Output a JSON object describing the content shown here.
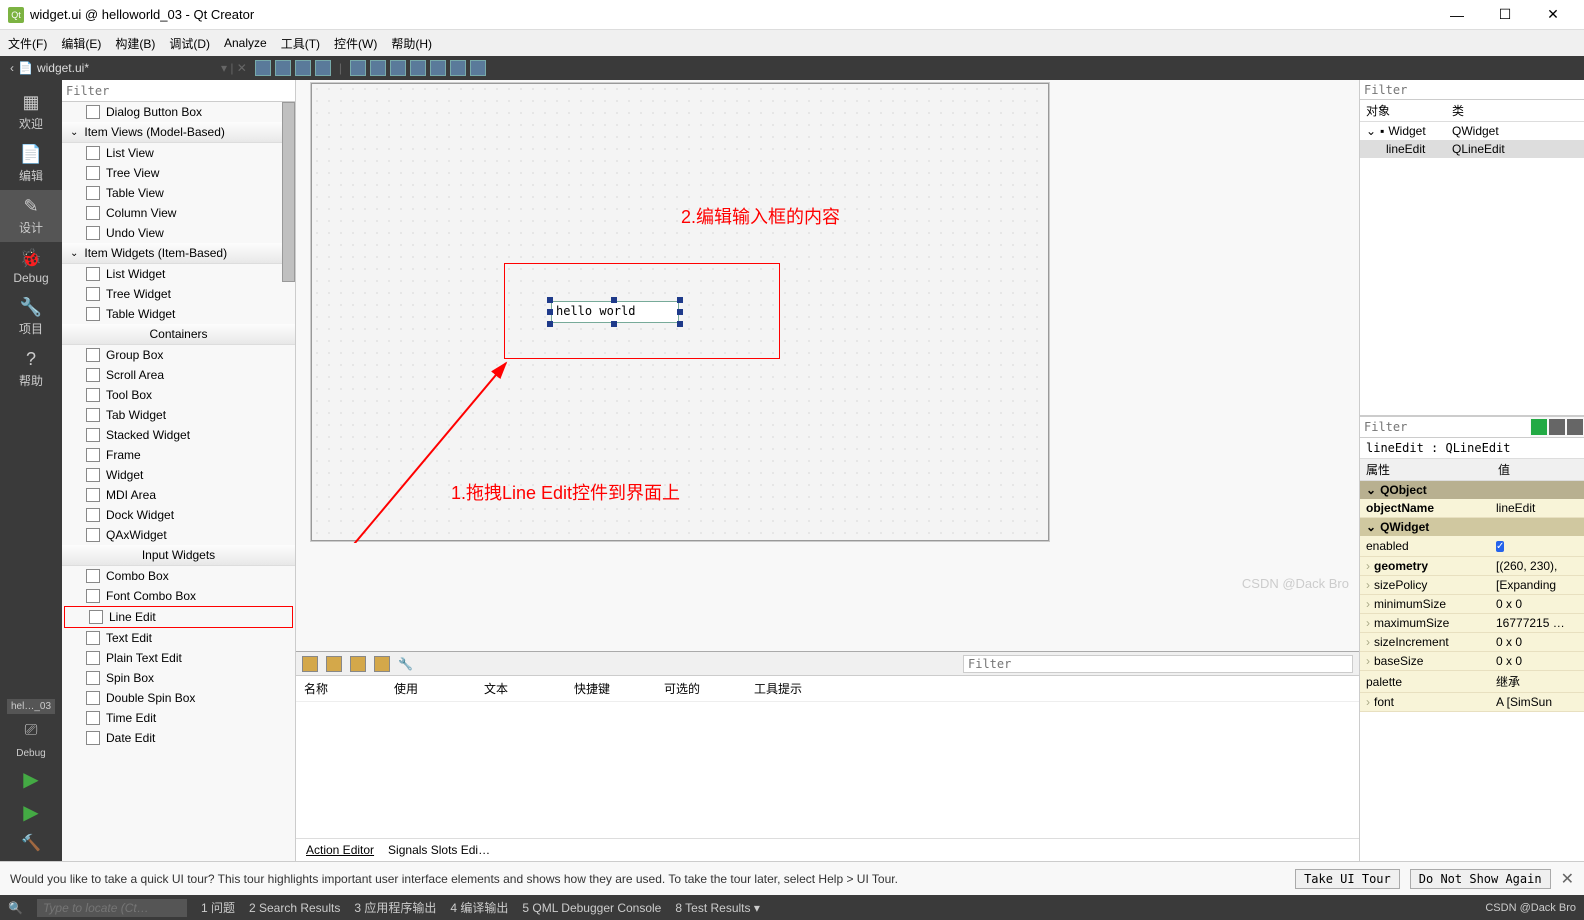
{
  "titlebar": {
    "title": "widget.ui @ helloworld_03 - Qt Creator",
    "min": "—",
    "max": "☐",
    "close": "✕"
  },
  "menubar": [
    "文件(F)",
    "编辑(E)",
    "构建(B)",
    "调试(D)",
    "Analyze",
    "工具(T)",
    "控件(W)",
    "帮助(H)"
  ],
  "toolbar": {
    "file": "widget.ui*"
  },
  "leftbar": {
    "items": [
      {
        "ico": "▦",
        "label": "欢迎"
      },
      {
        "ico": "📄",
        "label": "编辑"
      },
      {
        "ico": "✎",
        "label": "设计",
        "active": true
      },
      {
        "ico": "🐞",
        "label": "Debug"
      },
      {
        "ico": "🔧",
        "label": "项目"
      },
      {
        "ico": "?",
        "label": "帮助"
      }
    ],
    "tab": "hel…_03",
    "btm": [
      "⎚",
      "Debug",
      "▶",
      "▶",
      "🔨"
    ]
  },
  "widgetbox": {
    "filter_ph": "Filter",
    "items": [
      {
        "type": "wi",
        "label": "Dialog Button Box"
      },
      {
        "type": "cat",
        "label": "Item Views (Model-Based)"
      },
      {
        "type": "wi",
        "label": "List View"
      },
      {
        "type": "wi",
        "label": "Tree View"
      },
      {
        "type": "wi",
        "label": "Table View"
      },
      {
        "type": "wi",
        "label": "Column View"
      },
      {
        "type": "wi",
        "label": "Undo View"
      },
      {
        "type": "cat",
        "label": "Item Widgets (Item-Based)"
      },
      {
        "type": "wi",
        "label": "List Widget"
      },
      {
        "type": "wi",
        "label": "Tree Widget"
      },
      {
        "type": "wi",
        "label": "Table Widget"
      },
      {
        "type": "cat",
        "label": "Containers",
        "center": true
      },
      {
        "type": "wi",
        "label": "Group Box"
      },
      {
        "type": "wi",
        "label": "Scroll Area"
      },
      {
        "type": "wi",
        "label": "Tool Box"
      },
      {
        "type": "wi",
        "label": "Tab Widget"
      },
      {
        "type": "wi",
        "label": "Stacked Widget"
      },
      {
        "type": "wi",
        "label": "Frame"
      },
      {
        "type": "wi",
        "label": "Widget"
      },
      {
        "type": "wi",
        "label": "MDI Area"
      },
      {
        "type": "wi",
        "label": "Dock Widget"
      },
      {
        "type": "wi",
        "label": "QAxWidget"
      },
      {
        "type": "cat",
        "label": "Input Widgets",
        "center": true
      },
      {
        "type": "wi",
        "label": "Combo Box"
      },
      {
        "type": "wi",
        "label": "Font Combo Box"
      },
      {
        "type": "wi",
        "label": "Line Edit",
        "hl": true
      },
      {
        "type": "wi",
        "label": "Text Edit"
      },
      {
        "type": "wi",
        "label": "Plain Text Edit"
      },
      {
        "type": "wi",
        "label": "Spin Box"
      },
      {
        "type": "wi",
        "label": "Double Spin Box"
      },
      {
        "type": "wi",
        "label": "Time Edit"
      },
      {
        "type": "wi",
        "label": "Date Edit"
      }
    ]
  },
  "design": {
    "annot1": "2.编辑输入框的内容",
    "annot2": "1.拖拽Line Edit控件到界面上",
    "lineedit_text": "hello world"
  },
  "bottompane": {
    "filter_ph": "Filter",
    "cols": [
      "名称",
      "使用",
      "文本",
      "快捷键",
      "可选的",
      "工具提示"
    ],
    "tabs": [
      "Action Editor",
      "Signals Slots Edi…"
    ]
  },
  "objtree": {
    "filter_ph": "Filter",
    "hdr": [
      "对象",
      "类"
    ],
    "rows": [
      {
        "c1": "Widget",
        "c2": "QWidget",
        "indent": 0
      },
      {
        "c1": "lineEdit",
        "c2": "QLineEdit",
        "indent": 1,
        "sel": true
      }
    ]
  },
  "props": {
    "filter_ph": "Filter",
    "objlabel": "lineEdit : QLineEdit",
    "hdr": [
      "属性",
      "值"
    ],
    "groups": [
      {
        "name": "QObject",
        "rows": [
          {
            "n": "objectName",
            "v": "lineEdit",
            "bold": true
          }
        ]
      },
      {
        "name": "QWidget",
        "rows": [
          {
            "n": "enabled",
            "v": "",
            "chk": true
          },
          {
            "n": "geometry",
            "v": "[(260, 230),",
            "bold": true,
            "exp": true
          },
          {
            "n": "sizePolicy",
            "v": "[Expanding",
            "exp": true
          },
          {
            "n": "minimumSize",
            "v": "0 x 0",
            "exp": true
          },
          {
            "n": "maximumSize",
            "v": "16777215 …",
            "exp": true
          },
          {
            "n": "sizeIncrement",
            "v": "0 x 0",
            "exp": true
          },
          {
            "n": "baseSize",
            "v": "0 x 0",
            "exp": true
          },
          {
            "n": "palette",
            "v": "继承"
          },
          {
            "n": "font",
            "v": "A [SimSun",
            "exp": true
          }
        ]
      }
    ]
  },
  "infobar": {
    "text": "Would you like to take a quick UI tour? This tour highlights important user interface elements and shows how they are used. To take the tour later, select Help > UI Tour.",
    "btn1": "Take UI Tour",
    "btn2": "Do Not Show Again"
  },
  "statusbar": {
    "search_ph": "Type to locate (Ct…",
    "items": [
      "1 问题",
      "2 Search Results",
      "3 应用程序输出",
      "4 编译输出",
      "5 QML Debugger Console",
      "8 Test Results ▾"
    ],
    "right": "CSDN @Dack Bro"
  },
  "watermark": "CSDN @Dack Bro"
}
